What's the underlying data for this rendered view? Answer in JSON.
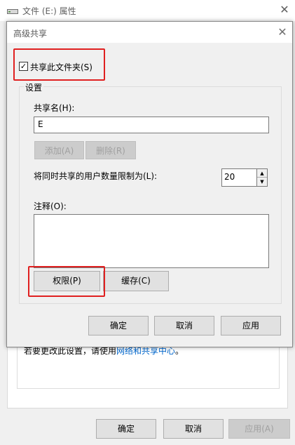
{
  "back_window": {
    "title": "文件 (E:) 属性",
    "close_glyph": "✕",
    "info_text": "若要更改此设置，请使用",
    "link_text": "网络和共享中心",
    "period": "。",
    "ok_label": "确定",
    "cancel_label": "取消",
    "apply_label": "应用(A)"
  },
  "dialog": {
    "title": "高级共享",
    "close_glyph": "✕",
    "share_checkbox_label": "共享此文件夹(S)",
    "share_checked": true,
    "settings_group_title": "设置",
    "share_name_label": "共享名(H):",
    "share_name_value": "E",
    "add_label": "添加(A)",
    "remove_label": "删除(R)",
    "user_limit_label": "将同时共享的用户数量限制为(L):",
    "user_limit_value": "20",
    "comment_label": "注释(O):",
    "comment_value": "",
    "permissions_label": "权限(P)",
    "caching_label": "缓存(C)",
    "ok_label": "确定",
    "cancel_label": "取消",
    "apply_label": "应用"
  },
  "highlight_color": "#e02020",
  "link_color": "#0066cc"
}
